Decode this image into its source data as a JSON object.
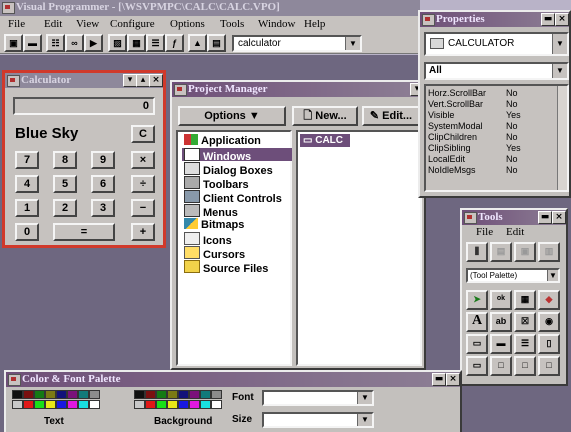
{
  "main_window": {
    "title": "Visual Programmer - [\\WSVPMPC\\CALC\\CALC.VPO]",
    "menu": [
      "File",
      "Edit",
      "View",
      "Configure",
      "Options",
      "Tools",
      "Window",
      "Help"
    ],
    "toolbar_combo_value": "calculator"
  },
  "calculator": {
    "title": "Calculator",
    "display": "0",
    "brand": "Blue Sky",
    "clear_label": "C",
    "keys": [
      "7",
      "8",
      "9",
      "×",
      "4",
      "5",
      "6",
      "÷",
      "1",
      "2",
      "3",
      "−",
      "0",
      "=",
      "+"
    ]
  },
  "project_manager": {
    "title": "Project Manager",
    "options_label": "Options",
    "new_label": "New...",
    "edit_label": "Edit...",
    "items": [
      "Application",
      "Windows",
      "Dialog Boxes",
      "Toolbars",
      "Client Controls",
      "Menus",
      "Bitmaps",
      "Icons",
      "Cursors",
      "Source Files"
    ],
    "selected_item": "Windows",
    "windows": [
      "CALC"
    ]
  },
  "properties": {
    "title": "Properties",
    "object": "CALCULATOR",
    "filter": "All",
    "rows": [
      {
        "key": "Horz.ScrollBar",
        "value": "No"
      },
      {
        "key": "Vert.ScrollBar",
        "value": "No"
      },
      {
        "key": "Visible",
        "value": "Yes"
      },
      {
        "key": "SystemModal",
        "value": "No"
      },
      {
        "key": "ClipChildren",
        "value": "No"
      },
      {
        "key": "ClipSibling",
        "value": "Yes"
      },
      {
        "key": "LocalEdit",
        "value": "No"
      },
      {
        "key": "NoIdleMsgs",
        "value": "No"
      }
    ]
  },
  "tools": {
    "title": "Tools",
    "menu": [
      "File",
      "Edit"
    ],
    "palette_combo": "(Tool Palette)"
  },
  "color_palette": {
    "title": "Color & Font Palette",
    "text_label": "Text",
    "background_label": "Background",
    "font_label": "Font",
    "size_label": "Size",
    "colors": [
      "#101010",
      "#7a1010",
      "#147a14",
      "#7a7a14",
      "#12127a",
      "#7a127a",
      "#127a7a",
      "#8c8c8c",
      "#c8c8c8",
      "#e01818",
      "#18e018",
      "#e8e818",
      "#1818e0",
      "#e018e0",
      "#18e0e0",
      "#ffffff"
    ]
  }
}
